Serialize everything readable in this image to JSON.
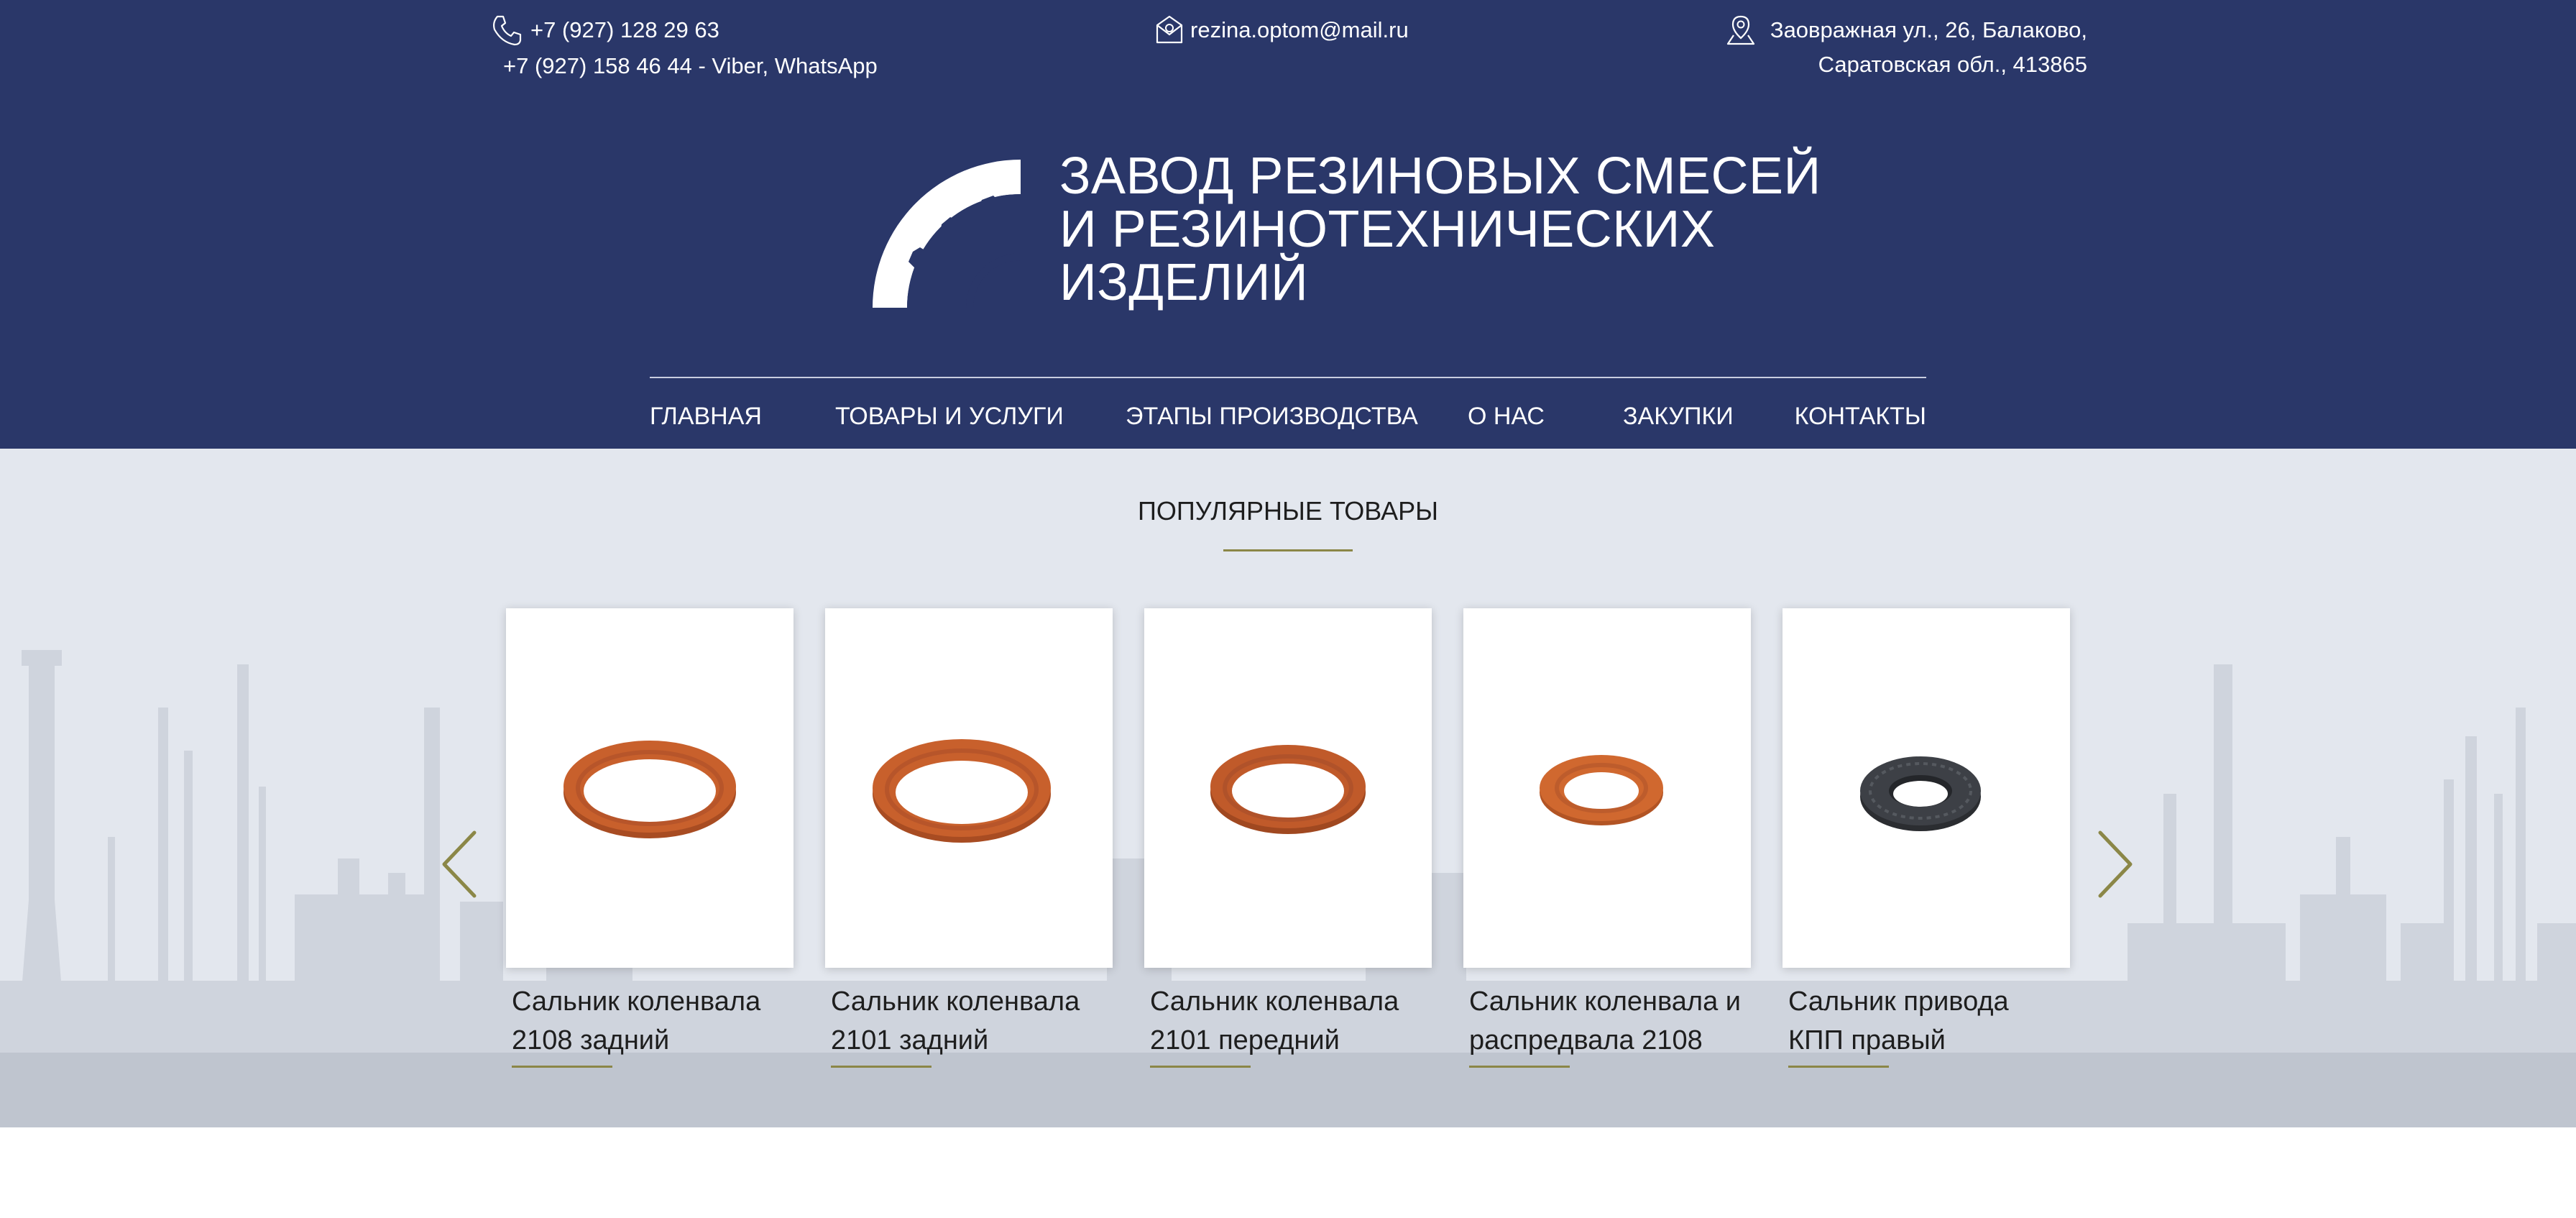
{
  "header": {
    "phone_1": "+7 (927) 128 29 63",
    "phone_2": "+7 (927) 158 46 44 - Viber, WhatsApp",
    "email": "rezina.optom@mail.ru",
    "address_1": "Заовражная ул., 26, Балаково,",
    "address_2": "Саратовская обл., 413865",
    "logo_line_1": "ЗАВОД РЕЗИНОВЫХ СМЕСЕЙ",
    "logo_line_2": "И РЕЗИНОТЕХНИЧЕСКИХ",
    "logo_line_3": "ИЗДЕЛИЙ"
  },
  "nav": {
    "items": [
      {
        "label": "ГЛАВНАЯ"
      },
      {
        "label": "ТОВАРЫ И УСЛУГИ"
      },
      {
        "label": "ЭТАПЫ ПРОИЗВОДСТВА"
      },
      {
        "label": "О НАС"
      },
      {
        "label": "ЗАКУПКИ"
      },
      {
        "label": "КОНТАКТЫ"
      }
    ]
  },
  "popular": {
    "title": "ПОПУЛЯРНЫЕ ТОВАРЫ",
    "products": [
      {
        "name": "Сальник коленвала 2108 задний",
        "material_color": "#c8602c"
      },
      {
        "name": "Сальник коленвала 2101 задний",
        "material_color": "#c8602c"
      },
      {
        "name": "Сальник коленвала 2101 передний",
        "material_color": "#c05a2a"
      },
      {
        "name": "Сальник коленвала и распредвала 2108",
        "material_color": "#d0682f"
      },
      {
        "name": "Сальник привода КПП правый",
        "material_color": "#3d4046"
      }
    ]
  },
  "icons": {
    "phone": "phone-icon",
    "email": "email-icon",
    "address": "location-pin-icon",
    "prev": "chevron-left-icon",
    "next": "chevron-right-icon"
  },
  "colors": {
    "header_bg": "#2a3769",
    "section_bg": "#e3e7ee",
    "accent": "#8b8747",
    "text_dark": "#1e1e1e"
  }
}
